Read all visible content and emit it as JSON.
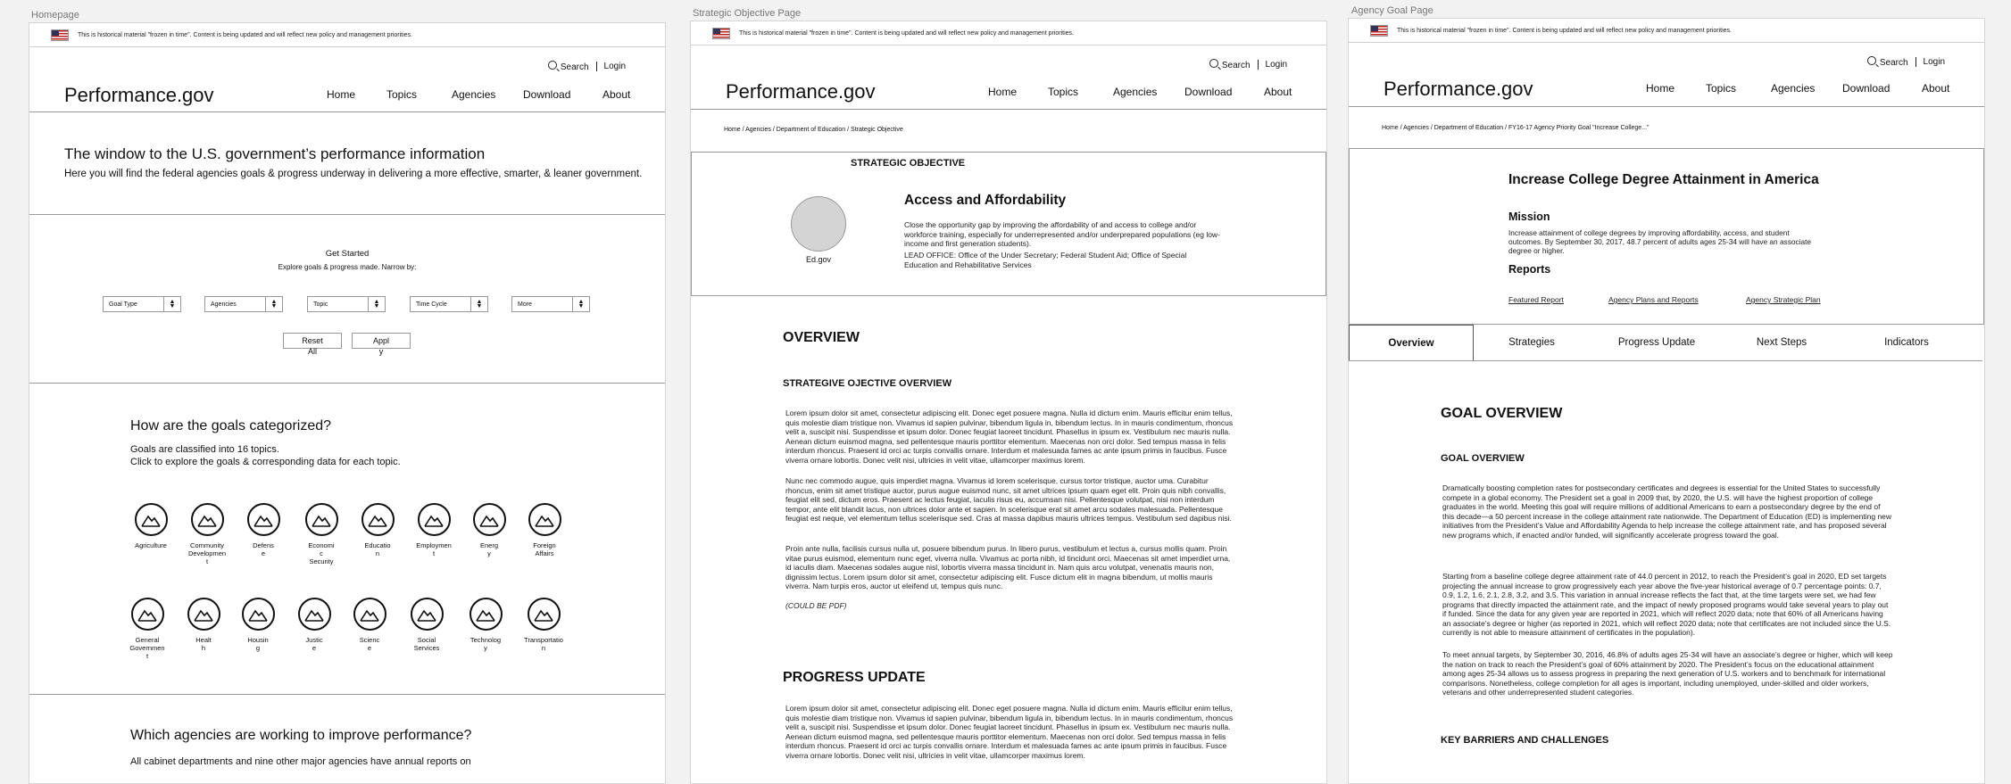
{
  "frames": {
    "homepage_label": "Homepage",
    "strategic_label": "Strategic Objective Page",
    "agency_label": "Agency Goal Page"
  },
  "banner_text": "This is historical material \"frozen in time\". Content is being updated and will reflect new policy and management priorities.",
  "header": {
    "search": "Search",
    "login": "Login",
    "logo": "Performance.gov",
    "nav": [
      "Home",
      "Topics",
      "Agencies",
      "Download",
      "About"
    ]
  },
  "home": {
    "hero_title": "The window to the U.S. government’s performance information",
    "hero_sub": "Here you will find the federal agencies goals & progress underway in delivering a more effective, smarter, & leaner government.",
    "get_started": "Get Started",
    "explore": "Explore goals & progress made. Narrow by:",
    "filters": [
      "Goal Type",
      "Agencies",
      "Topic",
      "Time Cycle",
      "More"
    ],
    "reset_1": "Reset",
    "reset_2": "All",
    "apply_1": "Appl",
    "apply_2": "y",
    "categories_title": "How are the goals categorized?",
    "categories_sub_1": "Goals are classified into 16 topics.",
    "categories_sub_2": "Click to explore the goals & corresponding data for each topic.",
    "topics_row1": [
      [
        "Agriculture"
      ],
      [
        "Community",
        "Developmen",
        "t"
      ],
      [
        "Defens",
        "e"
      ],
      [
        "Economi",
        "c",
        "Security"
      ],
      [
        "Educatio",
        "n"
      ],
      [
        "Employmen",
        "t"
      ],
      [
        "Energ",
        "y"
      ],
      [
        "Foreign",
        "Affairs"
      ]
    ],
    "topics_row2": [
      [
        "General",
        "Governmen",
        "t"
      ],
      [
        "Healt",
        "h"
      ],
      [
        "Housin",
        "g"
      ],
      [
        "Justic",
        "e"
      ],
      [
        "Scienc",
        "e"
      ],
      [
        "Social",
        "Services"
      ],
      [
        "Technolog",
        "y"
      ],
      [
        "Transportatio",
        "n"
      ]
    ],
    "agencies_title": "Which agencies are working to improve performance?",
    "agencies_sub": "All cabinet departments and nine other major agencies have annual reports on"
  },
  "strategic": {
    "breadcrumb": "Home / Agencies / Department of Education / Strategic Objective",
    "section_label": "STRATEGIC OBJECTIVE",
    "agency_logo": "Ed.gov",
    "title": "Access and Affordability",
    "desc": "Close the opportunity gap by improving the affordability of and access to college and/or workforce training, especially for underrepresented and/or underprepared populations (eg low-income and first generation students).",
    "lead_office": "LEAD OFFICE: Office of the Under Secretary; Federal Student Aid; Office of Special Education and Rehabilitative Services",
    "overview_title": "OVERVIEW",
    "overview_sub": "STRATEGIVE OJECTIVE OVERVIEW",
    "lorem1": "Lorem ipsum dolor sit amet, consectetur adipiscing elit. Donec eget posuere magna. Nulla id dictum enim. Mauris efficitur enim tellus, quis molestie diam tristique non. Vivamus id sapien pulvinar, bibendum ligula in, bibendum lectus. In in mauris condimentum, rhoncus velit a, suscipit nisi. Suspendisse et ipsum dolor. Donec feugiat laoreet tincidunt. Phasellus in ipsum ex. Vestibulum nec mauris nulla. Aenean dictum euismod magna, sed pellentesque mauris porttitor elementum. Maecenas non orci dolor. Sed tempus massa in felis interdum rhoncus. Praesent id orci ac turpis convallis ornare. Interdum et malesuada fames ac ante ipsum primis in faucibus. Fusce viverra ornare lobortis. Donec velit nisi, ultricies in velit vitae, ullamcorper maximus lorem.",
    "lorem2": "Nunc nec commodo augue, quis imperdiet magna. Vivamus id lorem scelerisque, cursus tortor tristique, auctor uma. Curabitur rhoncus, enim sit amet tristique auctor, purus augue euismod nunc, sit amet ultrices ipsum quam eget elit. Proin quis nibh convallis, feugiat elit sed, dictum eros. Praesent ac lectus feugiat, iaculis risus eu, accumsan nisi. Pellentesque volutpat, nisi non interdum tempor, ante elit blandit lacus, non ultrices dolor ante et sapien. In scelerisque erat sit amet arcu sodales malesuada. Pellentesque feugiat est neque, vel elementum tellus scelerisque sed. Cras at massa dapibus mauris ultrices tempus. Vestibulum sed dapibus nisi.",
    "lorem3": "Proin ante nulla, facilisis cursus nulla ut, posuere bibendum purus. In libero purus, vestibulum et lectus a, cursus mollis quam. Proin vitae purus euismod, elementum nunc eget, viverra nulla. Vivamus ac porta nibh, id tincidunt orci. Maecenas sit amet imperdiet urna, id iaculis diam. Maecenas sodales augue nisl, lobortis viverra massa tincidunt in. Nam quis arcu volutpat, venenatis mauris non, dignissim lectus. Lorem ipsum dolor sit amet, consectetur adipiscing elit. Fusce dictum elit in magna bibendum, ut mollis mauris viverra. Nam turpis eros, auctor ut eleifend ut, tempus quis nunc.",
    "could_be_pdf": "(COULD BE PDF)",
    "progress_title": "PROGRESS UPDATE",
    "lorem4": "Lorem ipsum dolor sit amet, consectetur adipiscing elit. Donec eget posuere magna. Nulla id dictum enim. Mauris efficitur enim tellus, quis molestie diam tristique non. Vivamus id sapien pulvinar, bibendum ligula in, bibendum lectus. In in mauris condimentum, rhoncus velit a, suscipit nisi. Suspendisse et ipsum dolor. Donec feugiat laoreet tincidunt. Phasellus in ipsum ex. Vestibulum nec mauris nulla. Aenean dictum euismod magna, sed pellentesque mauris porttitor elementum. Maecenas non orci dolor. Sed tempus massa in felis interdum rhoncus. Praesent id orci ac turpis convallis ornare. Interdum et malesuada fames ac ante ipsum primis in faucibus. Fusce viverra ornare lobortis. Donec velit nisi, ultricies in velit vitae, ullamcorper maximus lorem."
  },
  "agency": {
    "breadcrumb": "Home / Agencies / Department of Education / FY16-17 Agency Priority Goal \"Increase College...\"",
    "title": "Increase College Degree Attainment in America",
    "mission_label": "Mission",
    "mission_text": "Increase attainment of college degrees by improving affordability, access, and student outcomes. By September 30, 2017, 48.7 percent of adults ages 25-34 will have an associate degree or higher.",
    "reports_label": "Reports",
    "reports": [
      "Featured Report",
      "Agency Plans and Reports",
      "Agency Strategic Plan"
    ],
    "tabs": [
      "Overview",
      "Strategies",
      "Progress Update",
      "Next Steps",
      "Indicators"
    ],
    "goal_overview_title": "GOAL OVERVIEW",
    "goal_overview_sub": "GOAL OVERVIEW",
    "p1": "Dramatically boosting completion rates for postsecondary certificates and degrees is essential for the United States to successfully compete in a global economy. The President set a goal in 2009 that, by 2020, the U.S. will have the highest proportion of college graduates in the world. Meeting this goal will require millions of additional Americans to earn a postsecondary degree by the end of this decade—a 50 percent increase in the college attainment rate nationwide. The Department of Education (ED) is implementing new initiatives from the President’s Value and Affordability Agenda to help increase the college attainment rate, and has proposed several new programs which, if enacted and/or funded, will significantly accelerate progress toward the goal.",
    "p2": "Starting from a baseline college degree attainment rate of 44.0 percent in 2012, to reach the President’s goal in 2020, ED set targets projecting the annual increase to grow progressively each year above the five-year historical average of 0.7 percentage points: 0.7, 0.9, 1.2, 1.6, 2.1, 2.8, 3.2, and 3.5. This variation in annual increase reflects the fact that, at the time targets were set, we had few programs that directly impacted the attainment rate, and the impact of newly proposed programs would take several years to play out if funded. Since the data for any given year are reported in 2021, which will reflect 2020 data; note that 60% of all Americans having an associate’s degree or higher (as reported in 2021, which will reflect 2020 data; note that certificates are not included since the U.S. currently is not able to measure attainment of certificates in the population).",
    "p3": "To meet annual targets, by September 30, 2016, 46.8% of adults ages 25-34 will have an associate’s degree or higher, which will keep the nation on track to reach the President’s goal of 60% attainment by 2020. The President’s focus on the educational attainment among ages 25-34 allows us to assess progress in preparing the next generation of U.S. workers and to benchmark for international comparisons. Nonetheless, college completion for all ages is important, including unemployed, under-skilled and older workers, veterans and other underrepresented student categories.",
    "barriers_title": "KEY BARRIERS AND CHALLENGES"
  }
}
